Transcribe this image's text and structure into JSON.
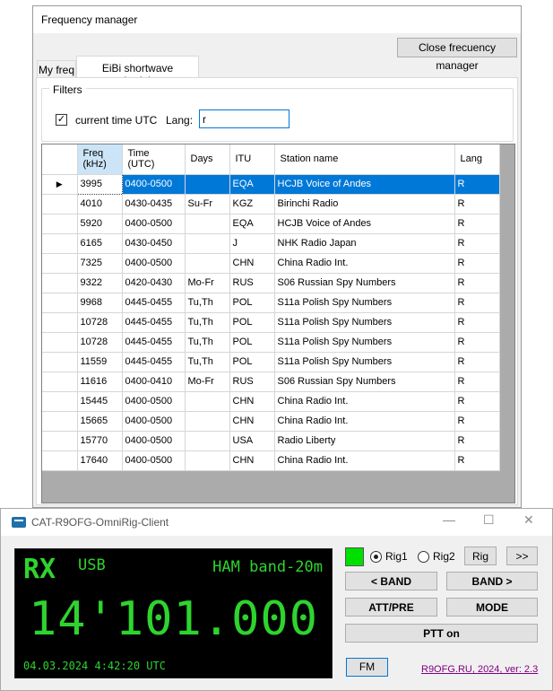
{
  "freq_manager": {
    "title": "Frequency manager",
    "close_button": "Close frecuency manager",
    "tabs": [
      "My freq",
      "EiBi shortwave schedules"
    ],
    "filters": {
      "legend": "Filters",
      "utc_checked": true,
      "utc_label": "current time UTC",
      "lang_label": "Lang:",
      "lang_value": "r"
    },
    "grid": {
      "headers": [
        "Freq\n(kHz)",
        "Time\n(UTC)",
        "Days",
        "ITU",
        "Station name",
        "Lang"
      ],
      "rows": [
        [
          "3995",
          "0400-0500",
          "",
          "EQA",
          "HCJB Voice of Andes",
          "R"
        ],
        [
          "4010",
          "0430-0435",
          "Su-Fr",
          "KGZ",
          "Birinchi Radio",
          "R"
        ],
        [
          "5920",
          "0400-0500",
          "",
          "EQA",
          "HCJB Voice of Andes",
          "R"
        ],
        [
          "6165",
          "0430-0450",
          "",
          "J",
          "NHK Radio Japan",
          "R"
        ],
        [
          "7325",
          "0400-0500",
          "",
          "CHN",
          "China Radio Int.",
          "R"
        ],
        [
          "9322",
          "0420-0430",
          "Mo-Fr",
          "RUS",
          "S06 Russian Spy Numbers",
          "R"
        ],
        [
          "9968",
          "0445-0455",
          "Tu,Th",
          "POL",
          "S11a Polish Spy Numbers",
          "R"
        ],
        [
          "10728",
          "0445-0455",
          "Tu,Th",
          "POL",
          "S11a Polish Spy Numbers",
          "R"
        ],
        [
          "10728",
          "0445-0455",
          "Tu,Th",
          "POL",
          "S11a Polish Spy Numbers",
          "R"
        ],
        [
          "11559",
          "0445-0455",
          "Tu,Th",
          "POL",
          "S11a Polish Spy Numbers",
          "R"
        ],
        [
          "11616",
          "0400-0410",
          "Mo-Fr",
          "RUS",
          "S06 Russian Spy Numbers",
          "R"
        ],
        [
          "15445",
          "0400-0500",
          "",
          "CHN",
          "China Radio Int.",
          "R"
        ],
        [
          "15665",
          "0400-0500",
          "",
          "CHN",
          "China Radio Int.",
          "R"
        ],
        [
          "15770",
          "0400-0500",
          "",
          "USA",
          "Radio Liberty",
          "R"
        ],
        [
          "17640",
          "0400-0500",
          "",
          "CHN",
          "China Radio Int.",
          "R"
        ]
      ],
      "selected_row": 0
    }
  },
  "cat_client": {
    "title": "CAT-R9OFG-OmniRig-Client",
    "window_controls": {
      "minimize": "—",
      "maximize": "☐",
      "close": "✕"
    },
    "display": {
      "rx": "RX",
      "mode": "USB",
      "band": "HAM band-20m",
      "frequency": "14'101.000",
      "datetime": "04.03.2024 4:42:20 UTC"
    },
    "rig1_label": "Rig1",
    "rig2_label": "Rig2",
    "rig_selected": "Rig1",
    "rig_button": "Rig",
    "more_button": ">>",
    "band_down": "< BAND",
    "band_up": "BAND >",
    "att_pre": "ATT/PRE",
    "mode_button": "MODE",
    "ptt_button": "PTT on",
    "fm_button": "FM",
    "about_link": "R9OFG.RU, 2024, ver: 2.3"
  },
  "colors": {
    "selection": "#0078d7",
    "display_green": "#2ed42e",
    "led_green": "#00e000",
    "link_purple": "#800080"
  }
}
